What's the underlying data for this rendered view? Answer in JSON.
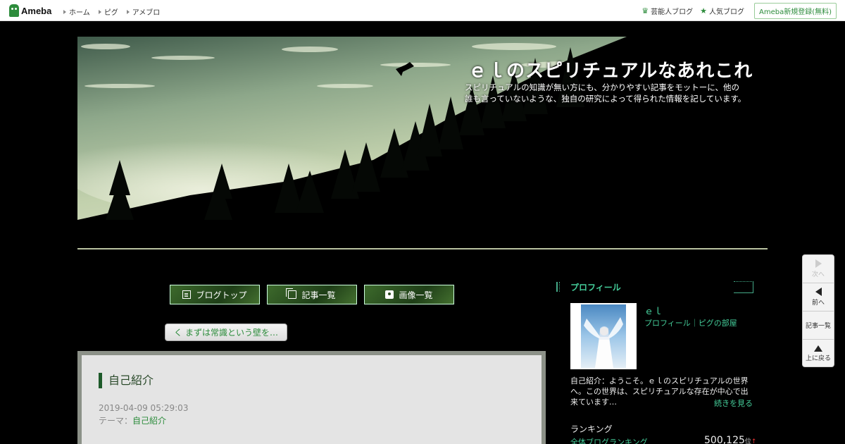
{
  "topbar": {
    "logo": "Ameba",
    "nav": [
      "ホーム",
      "ピグ",
      "アメブロ"
    ],
    "celebrity_blog": "芸能人ブログ",
    "popular_blog": "人気ブログ",
    "register": "Ameba新規登録(無料)"
  },
  "header": {
    "title": "ｅｌのスピリチュアルなあれこれ",
    "description": "スピリチュアルの知識が無い方にも、分かりやすい記事をモットーに、他の誰も言っていないような、独自の研究によって得られた情報を記しています。"
  },
  "nav_buttons": {
    "blog_top": "ブログトップ",
    "article_list": "記事一覧",
    "image_list": "画像一覧"
  },
  "prev_post": {
    "arrow": "く",
    "label": "まずは常識という壁を…"
  },
  "article": {
    "title": "自己紹介",
    "date": "2019-04-09 05:29:03",
    "theme_label": "テーマ：",
    "theme": "自己紹介"
  },
  "sidebar": {
    "profile_heading": "プロフィール",
    "name": "ｅｌ",
    "links": "プロフィール｜ピグの部屋",
    "intro": "自己紹介：ようこそ。ｅｌのスピリチュアルの世界へ。この世界は、スピリチュアルな存在が中心で出来ています…",
    "more": "続きを見る",
    "ranking_title": "ランキング",
    "ranking_label": "全体ブログランキング",
    "ranking_value": "500,125",
    "ranking_unit": "位",
    "ranking_trend": "↑"
  },
  "float_nav": {
    "next": "次へ",
    "prev": "前へ",
    "list": "記事一覧",
    "top": "上に戻る"
  },
  "colors": {
    "accent": "#2d8c3c",
    "link_green": "#44cc99",
    "title_bar": "#1e5a2a"
  }
}
